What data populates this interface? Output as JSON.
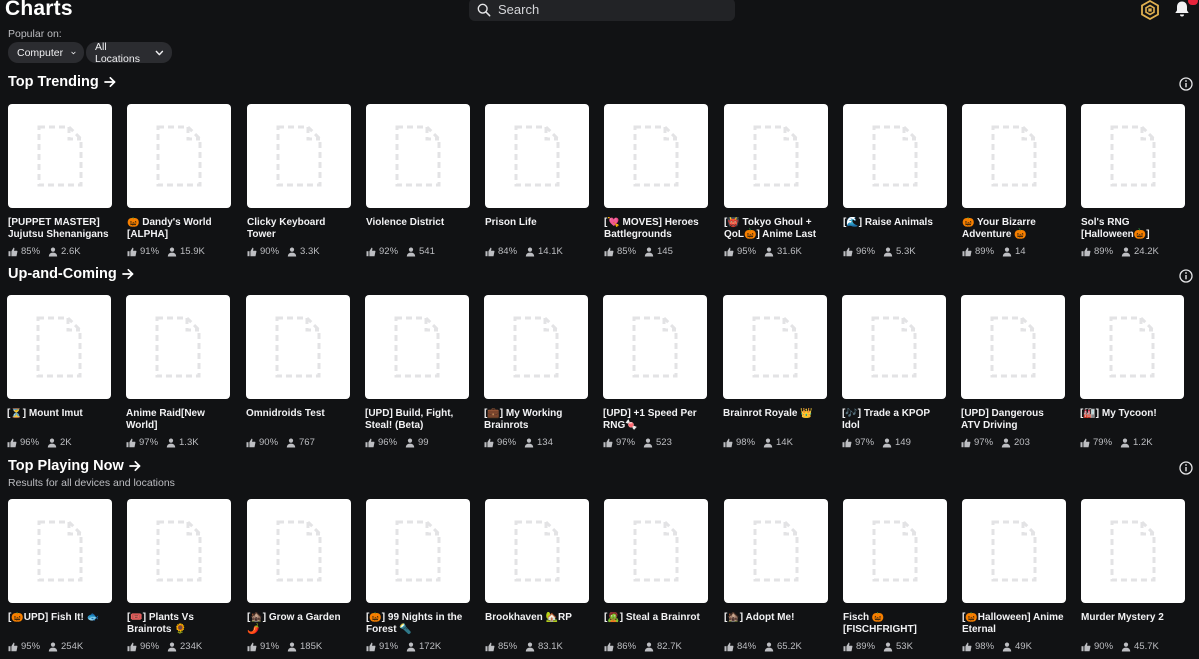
{
  "header": {
    "title": "Charts",
    "search_placeholder": "Search",
    "popular_on_label": "Popular on:",
    "device_filter": "Computer",
    "location_filter": "All Locations"
  },
  "sections": [
    {
      "title": "Top Trending",
      "subtitle": "",
      "games": [
        {
          "title": "[PUPPET MASTER] Jujutsu Shenanigans",
          "rating": "85%",
          "players": "2.6K"
        },
        {
          "title": "🎃 Dandy's World [ALPHA]",
          "rating": "91%",
          "players": "15.9K"
        },
        {
          "title": "Clicky Keyboard Tower",
          "rating": "90%",
          "players": "3.3K"
        },
        {
          "title": "Violence District",
          "rating": "92%",
          "players": "541"
        },
        {
          "title": "Prison Life",
          "rating": "84%",
          "players": "14.1K"
        },
        {
          "title": "[💘 MOVES] Heroes Battlegrounds",
          "rating": "85%",
          "players": "145"
        },
        {
          "title": "[👹 Tokyo Ghoul + QoL🎃] Anime Last Stand",
          "rating": "95%",
          "players": "31.6K"
        },
        {
          "title": "[🌊] Raise Animals",
          "rating": "96%",
          "players": "5.3K"
        },
        {
          "title": "🎃 Your Bizarre Adventure 🎃",
          "rating": "89%",
          "players": "14"
        },
        {
          "title": "Sol's RNG [Halloween🎃]",
          "rating": "89%",
          "players": "24.2K"
        }
      ]
    },
    {
      "title": "Up-and-Coming",
      "subtitle": "",
      "games": [
        {
          "title": "[⏳] Mount Imut",
          "rating": "96%",
          "players": "2K"
        },
        {
          "title": "Anime Raid[New World]",
          "rating": "97%",
          "players": "1.3K"
        },
        {
          "title": "Omnidroids Test",
          "rating": "90%",
          "players": "767"
        },
        {
          "title": "[UPD] Build, Fight, Steal! (Beta)",
          "rating": "96%",
          "players": "99"
        },
        {
          "title": "[💼] My Working Brainrots",
          "rating": "96%",
          "players": "134"
        },
        {
          "title": "[UPD] +1 Speed Per RNG🍬",
          "rating": "97%",
          "players": "523"
        },
        {
          "title": "Brainrot Royale 👑",
          "rating": "98%",
          "players": "14K"
        },
        {
          "title": "[🎶] Trade a KPOP Idol",
          "rating": "97%",
          "players": "149"
        },
        {
          "title": "[UPD] Dangerous ATV Driving",
          "rating": "97%",
          "players": "203"
        },
        {
          "title": "[🏭] My Tycoon!",
          "rating": "79%",
          "players": "1.2K"
        }
      ]
    },
    {
      "title": "Top Playing Now",
      "subtitle": "Results for all devices and locations",
      "games": [
        {
          "title": "[🎃UPD] Fish It! 🐟",
          "rating": "95%",
          "players": "254K"
        },
        {
          "title": "[🎟️] Plants Vs Brainrots 🌻",
          "rating": "96%",
          "players": "234K"
        },
        {
          "title": "[🏚️] Grow a Garden 🌶️",
          "rating": "91%",
          "players": "185K"
        },
        {
          "title": "[🎃] 99 Nights in the Forest 🔦",
          "rating": "91%",
          "players": "172K"
        },
        {
          "title": "Brookhaven 🏡RP",
          "rating": "85%",
          "players": "83.1K"
        },
        {
          "title": "[🧟] Steal a Brainrot",
          "rating": "86%",
          "players": "82.7K"
        },
        {
          "title": "[🏚️] Adopt Me!",
          "rating": "84%",
          "players": "65.2K"
        },
        {
          "title": "Fisch 🎃 [FISCHFRIGHT]",
          "rating": "89%",
          "players": "53K"
        },
        {
          "title": "[🎃Halloween] Anime Eternal",
          "rating": "98%",
          "players": "49K"
        },
        {
          "title": "Murder Mystery 2",
          "rating": "90%",
          "players": "45.7K"
        }
      ]
    }
  ],
  "icons": {
    "search": "search-icon",
    "robux": "robux-icon",
    "notifications": "bell-icon",
    "thumbnail": "file-placeholder-icon",
    "rating": "thumbs-up-icon",
    "players": "people-icon",
    "info": "info-icon"
  },
  "colors": {
    "background": "#111214",
    "surface": "#222326",
    "chip": "#2b2c30",
    "text": "#f7f7f8",
    "muted": "#bdbec2",
    "badge": "#e8243c",
    "robux": "#e0b050"
  }
}
